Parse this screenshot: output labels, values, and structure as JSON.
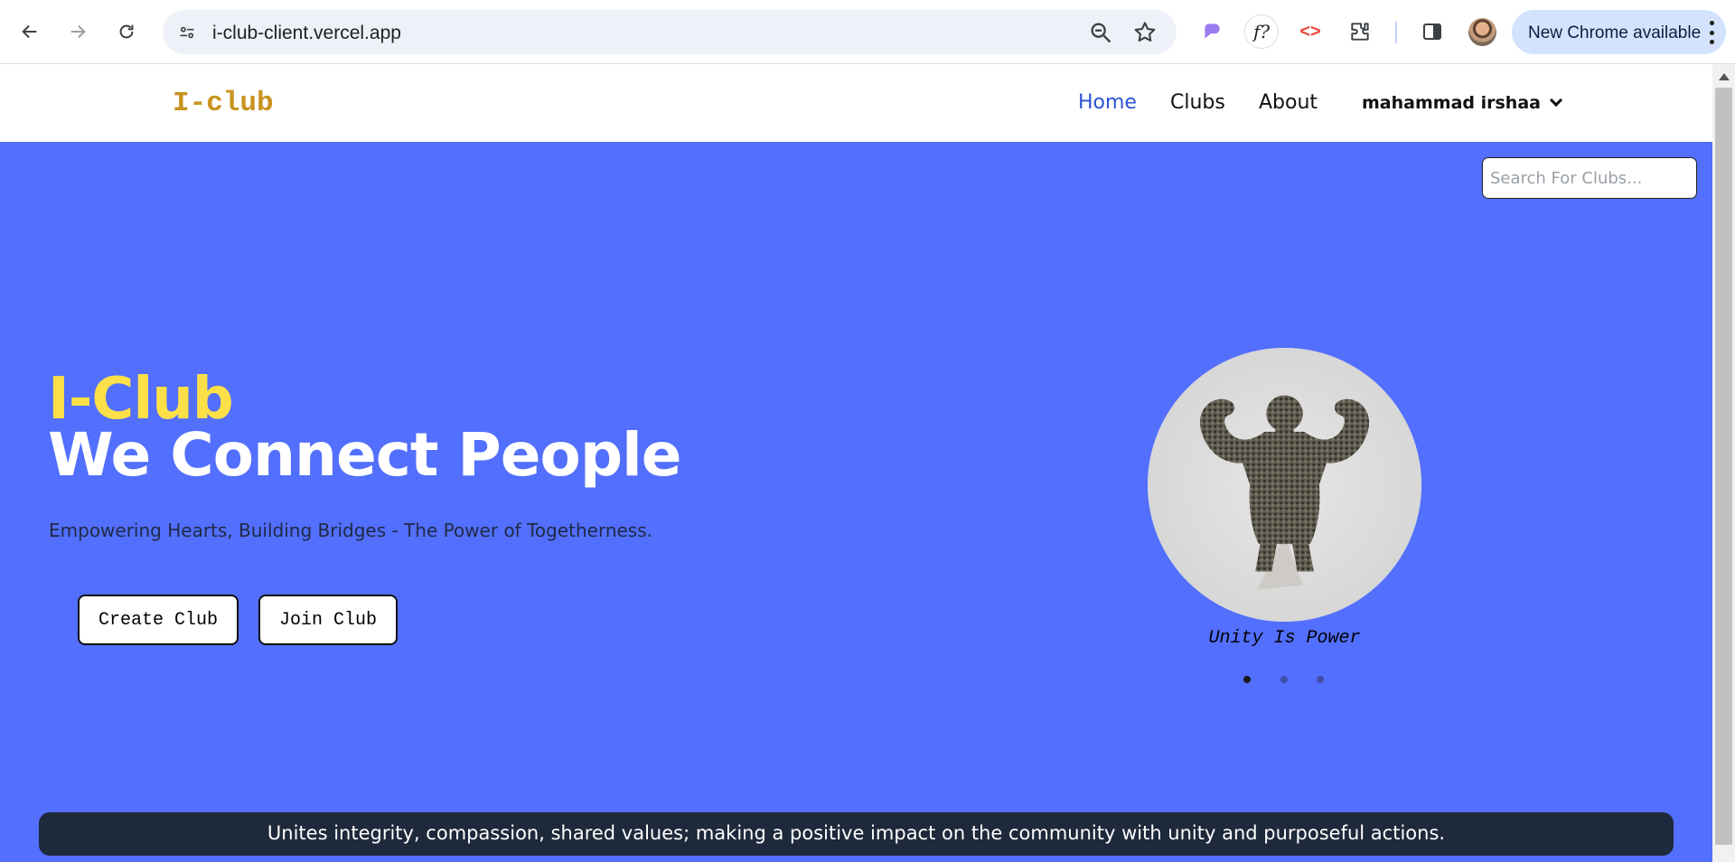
{
  "browser": {
    "url": "i-club-client.vercel.app",
    "update_label": "New Chrome available",
    "ext_f_label": "f?",
    "ext_code_label": "<>"
  },
  "header": {
    "logo": "I-club",
    "nav": [
      {
        "label": "Home",
        "active": true
      },
      {
        "label": "Clubs",
        "active": false
      },
      {
        "label": "About",
        "active": false
      }
    ],
    "user_name": "mahammad irshaa"
  },
  "search": {
    "placeholder": "Search For Clubs..."
  },
  "hero": {
    "brand": "I-Club",
    "tagline": "We Connect People",
    "subtitle": "Empowering Hearts, Building Bridges - The Power of Togetherness.",
    "create_button": "Create Club",
    "join_button": "Join Club"
  },
  "carousel": {
    "caption": "Unity Is Power",
    "slide_count": 3,
    "active_index": 0
  },
  "banner": {
    "text": "Unites integrity, compassion, shared values; making a positive impact on the community with unity and purposeful actions."
  },
  "colors": {
    "hero_bg": "#526ffd",
    "brand_yellow": "#fde047",
    "logo_gold": "#c8931f",
    "nav_active": "#2d52d6",
    "banner_bg": "#1e293b"
  }
}
